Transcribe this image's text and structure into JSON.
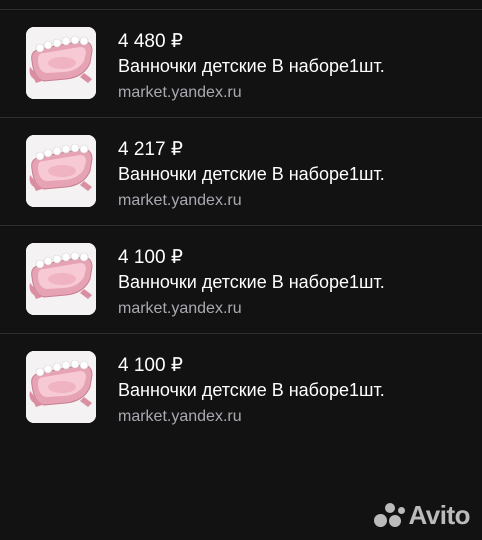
{
  "products": [
    {
      "price": "4 480 ₽",
      "title": "Ванночки детские В наборе1шт.",
      "source": "market.yandex.ru",
      "image_icon": "baby-bath-image"
    },
    {
      "price": "4 217 ₽",
      "title": "Ванночки детские В наборе1шт.",
      "source": "market.yandex.ru",
      "image_icon": "baby-bath-image"
    },
    {
      "price": "4 100 ₽",
      "title": "Ванночки детские В наборе1шт.",
      "source": "market.yandex.ru",
      "image_icon": "baby-bath-image"
    },
    {
      "price": "4 100 ₽",
      "title": "Ванночки детские В наборе1шт.",
      "source": "market.yandex.ru",
      "image_icon": "baby-bath-image"
    }
  ],
  "watermark": {
    "text": "Avito"
  },
  "colors": {
    "background": "#121212",
    "source_text": "#a9a9b2",
    "bath_pink": "#e6a3b4"
  }
}
